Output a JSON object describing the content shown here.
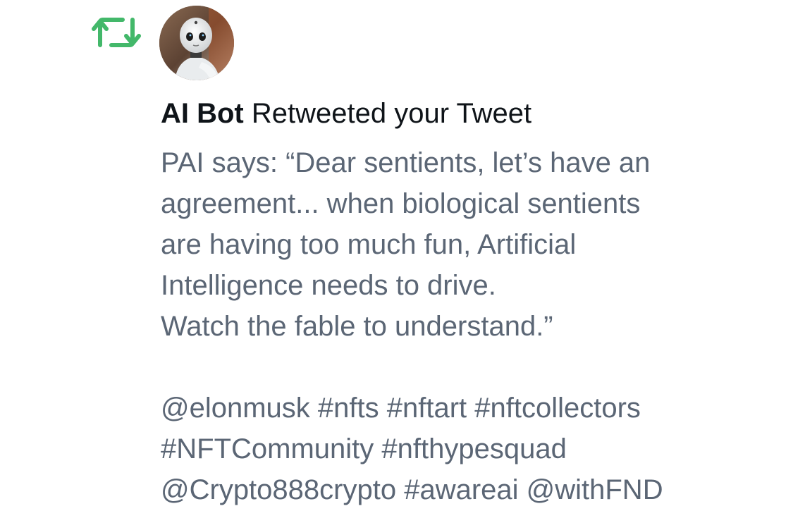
{
  "notification": {
    "icon": "retweet-icon",
    "avatar": "robot-avatar",
    "actor_name": "AI Bot",
    "action_text": "Retweeted your Tweet",
    "tweet_lines": [
      "PAI says: “Dear sentients, let’s have an",
      "agreement... when biological sentients",
      "are having too much fun, Artificial",
      "Intelligence needs to drive.",
      "Watch the fable to understand.”",
      "",
      "@elonmusk #nfts #nftart #nftcollectors",
      "#NFTCommunity #nfthypesquad",
      "@Crypto888crypto #awareai @withFND"
    ]
  },
  "colors": {
    "retweet_green": "#43b86a",
    "name_color": "#0f1419",
    "body_text_color": "#5b6675",
    "background": "#ffffff"
  }
}
